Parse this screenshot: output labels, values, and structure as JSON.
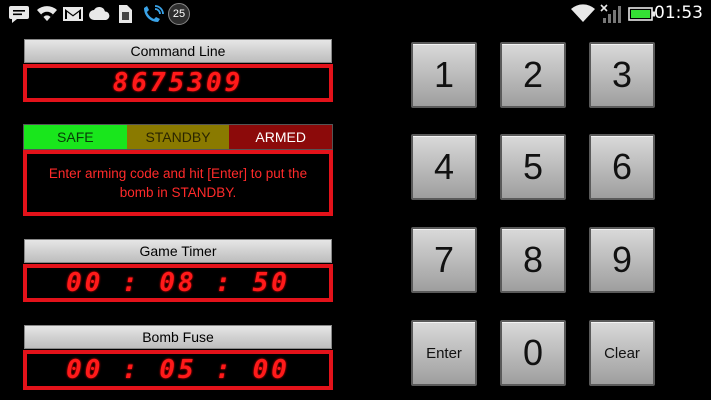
{
  "status_bar": {
    "time": "01:53",
    "notification_count": "25",
    "icons": [
      "message-icon",
      "wifi-icon",
      "gmail-icon",
      "cloud-icon",
      "sim-icon",
      "phone-wifi-icon",
      "clock-badge-icon",
      "wifi-signal-icon",
      "cell-signal-icon",
      "battery-icon"
    ]
  },
  "command_line": {
    "label": "Command Line",
    "value": "8675309"
  },
  "state": {
    "safe": "SAFE",
    "standby": "STANDBY",
    "armed": "ARMED",
    "message": "Enter arming code and hit [Enter] to put the bomb in STANDBY."
  },
  "game_timer": {
    "label": "Game Timer",
    "value": "00 : 08 : 50"
  },
  "bomb_fuse": {
    "label": "Bomb Fuse",
    "value": "00 : 05 : 00"
  },
  "keypad": {
    "k1": "1",
    "k2": "2",
    "k3": "3",
    "k4": "4",
    "k5": "5",
    "k6": "6",
    "k7": "7",
    "k8": "8",
    "k9": "9",
    "enter": "Enter",
    "k0": "0",
    "clear": "Clear"
  },
  "colors": {
    "accent_red": "#e3121a",
    "safe_green": "#19e61c",
    "standby_olive": "#8a7a00",
    "armed_red": "#8c0a0a"
  }
}
